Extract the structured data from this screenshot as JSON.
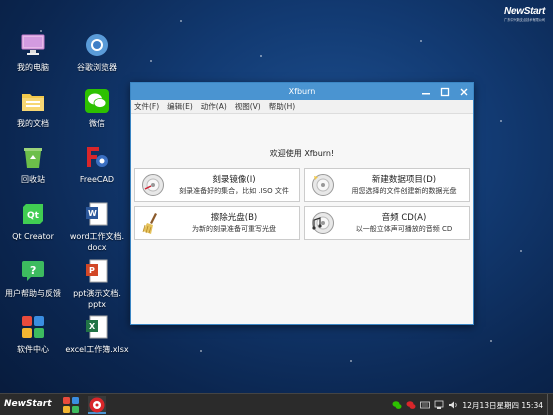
{
  "brand": {
    "name": "NewStart",
    "tagline": "广东中兴新支点技术有限公司"
  },
  "desktop": {
    "icons": [
      {
        "label": "我的电脑",
        "icon": "monitor-icon"
      },
      {
        "label": "谷歌浏览器",
        "icon": "browser-icon"
      },
      {
        "label": "我的文档",
        "icon": "folder-icon"
      },
      {
        "label": "微信",
        "icon": "wechat-icon"
      },
      {
        "label": "回收站",
        "icon": "recycle-bin-icon"
      },
      {
        "label": "FreeCAD",
        "icon": "freecad-icon"
      },
      {
        "label": "Qt Creator",
        "icon": "qt-creator-icon"
      },
      {
        "label": "word工作文档.docx",
        "line1": "word工作文档.",
        "line2": "docx",
        "icon": "word-doc-icon"
      },
      {
        "label": "用户帮助与反馈",
        "icon": "help-feedback-icon"
      },
      {
        "label": "ppt演示文档.pptx",
        "line1": "ppt演示文档.",
        "line2": "pptx",
        "icon": "ppt-doc-icon"
      },
      {
        "label": "软件中心",
        "icon": "software-center-icon"
      },
      {
        "label": "excel工作簿.xlsx",
        "icon": "excel-doc-icon"
      }
    ]
  },
  "window": {
    "title": "Xfburn",
    "menu": [
      "文件(F)",
      "编辑(E)",
      "动作(A)",
      "视图(V)",
      "帮助(H)"
    ],
    "welcome": "欢迎使用 Xfburn!",
    "actions": [
      {
        "title": "刻录镜像(I)",
        "desc": "刻录准备好的集合，比如 .ISO 文件",
        "icon": "burn-image-icon"
      },
      {
        "title": "新建数据项目(D)",
        "desc": "用您选择的文件创建新的数据光盘",
        "icon": "new-data-project-icon"
      },
      {
        "title": "擦除光盘(B)",
        "desc": "为新的刻录准备可重写光盘",
        "icon": "blank-disc-icon"
      },
      {
        "title": "音频 CD(A)",
        "desc": "以一般立体声可播放的音频 CD",
        "icon": "audio-cd-icon"
      }
    ]
  },
  "taskbar": {
    "start_label": "NewStart",
    "clock": "12月13日星期四 15:34"
  },
  "colors": {
    "titlebar": "#4a94d1",
    "taskbar": "#2b2b2b",
    "desktop": "#123a72"
  }
}
